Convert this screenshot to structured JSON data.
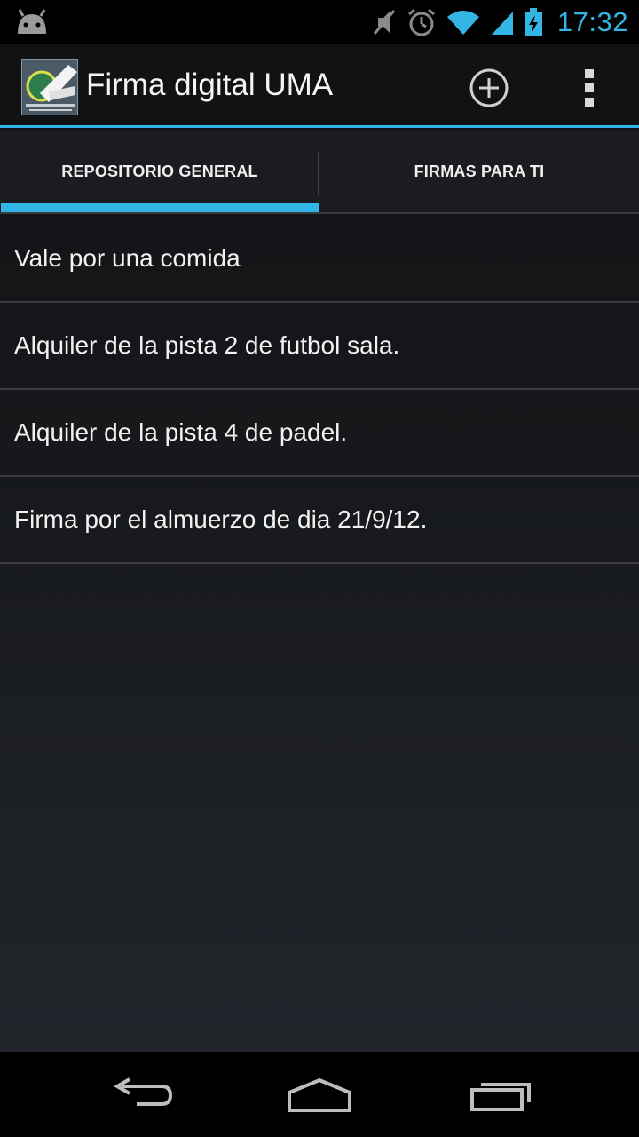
{
  "status_bar": {
    "time": "17:32",
    "icons": [
      "android-icon",
      "mute-icon",
      "alarm-icon",
      "wifi-icon",
      "signal-icon",
      "battery-charging-icon"
    ]
  },
  "action_bar": {
    "title": "Firma digital UMA",
    "logo_icon": "uma-logo-icon",
    "actions": [
      "add-icon",
      "overflow-menu-icon"
    ]
  },
  "tabs": [
    {
      "label": "REPOSITORIO GENERAL",
      "selected": true
    },
    {
      "label": "FIRMAS PARA TI",
      "selected": false
    }
  ],
  "list": {
    "items": [
      "Vale por una comida",
      "Alquiler de la pista 2 de futbol sala.",
      "Alquiler de la pista 4 de padel.",
      "Firma por el almuerzo de dia 21/9/12."
    ]
  },
  "nav_bar": {
    "buttons": [
      "back-icon",
      "home-icon",
      "recents-icon"
    ]
  },
  "colors": {
    "accent": "#33b5e5",
    "status_bar": "#000000",
    "action_bar": "#101214"
  }
}
